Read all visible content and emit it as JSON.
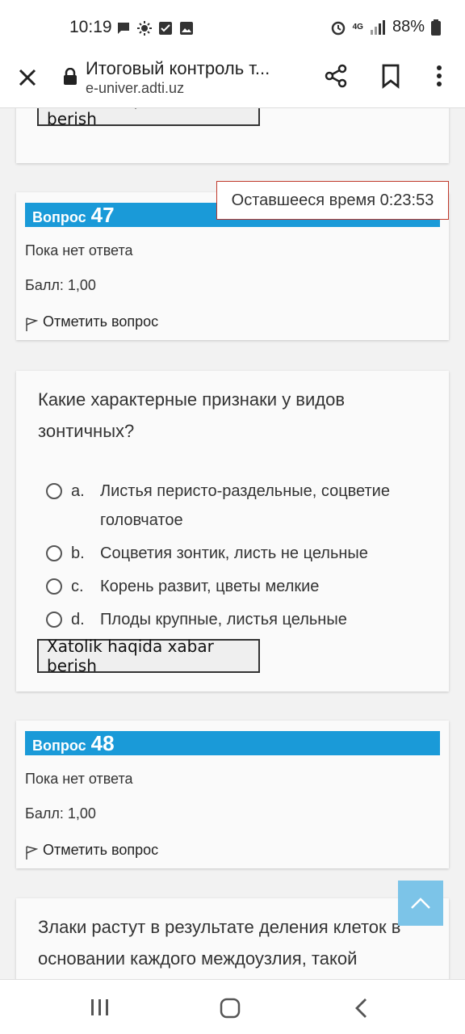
{
  "status_bar": {
    "time": "10:19",
    "network": "4G",
    "battery": "88%",
    "icons_left": [
      "chat-icon",
      "brightness-icon",
      "checkbox-icon",
      "image-icon"
    ],
    "icons_right": [
      "alarm-icon",
      "signal-icon",
      "battery-icon"
    ]
  },
  "browser": {
    "title": "Итоговый контроль т...",
    "url": "e-univer.adti.uz"
  },
  "report_label": "Xatolik haqida xabar berish",
  "timer": "Оставшееся время 0:23:53",
  "question47": {
    "label": "Вопрос",
    "number": "47",
    "status": "Пока нет ответа",
    "grade": "Балл: 1,00",
    "flag": "Отметить вопрос",
    "text": "Какие характерные признаки у видов зонтичных?",
    "answers": [
      {
        "letter": "a.",
        "text": "Листья перисто-раздельные, соцветие головчатое"
      },
      {
        "letter": "b.",
        "text": "Соцветия зонтик, листь не цельные"
      },
      {
        "letter": "c.",
        "text": "Корень развит, цветы мелкие"
      },
      {
        "letter": "d.",
        "text": "Плоды крупные, листья цельные"
      }
    ]
  },
  "question48": {
    "label": "Вопрос",
    "number": "48",
    "status": "Пока нет ответа",
    "grade": "Балл: 1,00",
    "flag": "Отметить вопрос",
    "text": "Злаки растут в результате деления клеток в основании каждого междоузлия, такой"
  },
  "colors": {
    "accent": "#1a9ad8",
    "timer_border": "#c0392b",
    "scroll_top": "#7cc4e8"
  }
}
